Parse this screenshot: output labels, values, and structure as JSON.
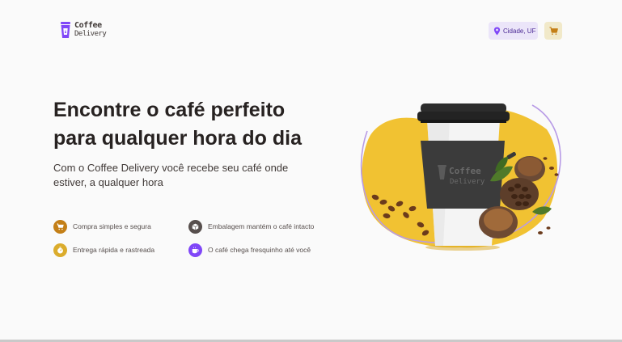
{
  "header": {
    "logo": {
      "brand": "Coffee",
      "sub": "Delivery",
      "icon": "coffee-cup-icon"
    },
    "location": {
      "label": "Cidade, UF",
      "icon": "map-pin-icon"
    },
    "cart": {
      "icon": "shopping-cart-icon"
    }
  },
  "hero": {
    "title": "Encontre o café perfeito para qualquer hora do dia",
    "subtitle": "Com o Coffee Delivery você recebe seu café onde estiver, a qualquer hora",
    "features": [
      {
        "label": "Compra simples e segura",
        "icon": "shopping-cart-icon",
        "color": "#c47f17"
      },
      {
        "label": "Embalagem mantém o café intacto",
        "icon": "package-icon",
        "color": "#574f4d"
      },
      {
        "label": "Entrega rápida e rastreada",
        "icon": "timer-icon",
        "color": "#dbac2c"
      },
      {
        "label": "O café chega fresquinho até você",
        "icon": "coffee-icon",
        "color": "#8047f8"
      }
    ],
    "image": {
      "cup_brand": "Coffee",
      "cup_sub": "Delivery",
      "colors": {
        "yellow": "#f1c232",
        "purple_ring": "#b89be6",
        "cup": "#f4f4f4",
        "sleeve": "#3b3b3b",
        "lid": "#2c2c2c"
      }
    }
  },
  "colors": {
    "purple": "#8047f8",
    "purple_dark": "#4b2995",
    "purple_light": "#ebe5f9",
    "yellow_dark": "#c47f17",
    "yellow": "#dbac2c",
    "yellow_light": "#f1e9c9",
    "text_title": "#272221",
    "text_base": "#403937"
  }
}
